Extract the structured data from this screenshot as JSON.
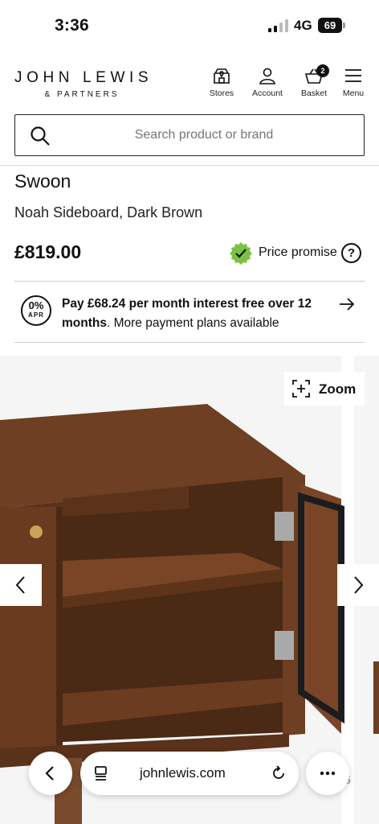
{
  "status_bar": {
    "time": "3:36",
    "network": "4G",
    "battery": "69"
  },
  "header": {
    "logo_line1": "JOHN LEWIS",
    "logo_line2": "& PARTNERS",
    "nav": {
      "stores": "Stores",
      "account": "Account",
      "basket": "Basket",
      "basket_count": "2",
      "menu": "Menu"
    }
  },
  "search": {
    "placeholder": "Search product or brand"
  },
  "product": {
    "brand": "Swoon",
    "name": "Noah Sideboard, Dark Brown",
    "price": "£819.00",
    "price_promise": "Price promise",
    "help_glyph": "?"
  },
  "finance": {
    "apr_percent": "0%",
    "apr_label": "APR",
    "bold_text": "Pay £68.24 per month interest free over 12 months",
    "rest_text": ". More payment plans available"
  },
  "gallery": {
    "zoom_label": "Zoom",
    "page_indicator": "5"
  },
  "browser": {
    "url": "johnlewis.com"
  },
  "colors": {
    "promise_green": "#7cc242",
    "wood": "#6b3d22"
  }
}
